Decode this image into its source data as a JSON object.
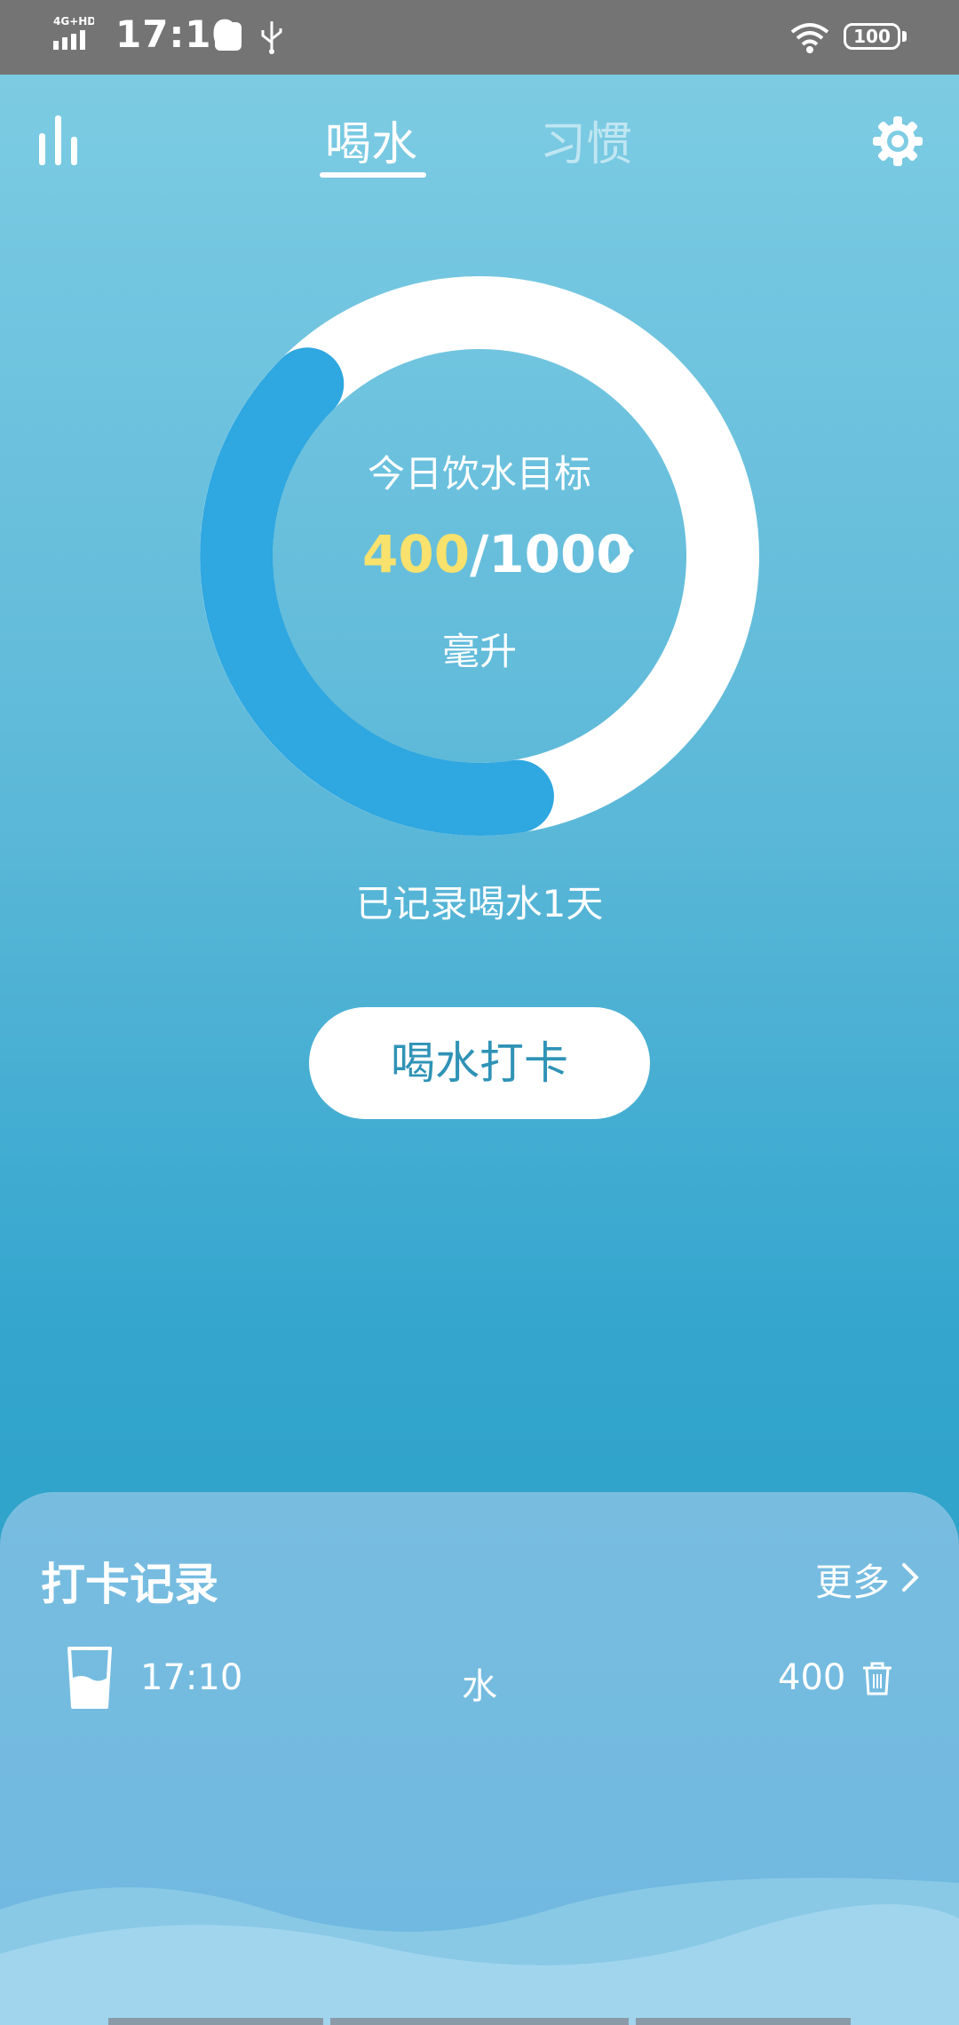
{
  "status_bar": {
    "network": "4G+HD",
    "time": "17:10",
    "battery": "100"
  },
  "header": {
    "tabs": [
      {
        "label": "喝水",
        "active": true
      },
      {
        "label": "习惯",
        "active": false
      }
    ],
    "icons": {
      "left": "bar-chart-icon",
      "right": "gear-icon"
    }
  },
  "goal": {
    "title": "今日饮水目标",
    "current": "400",
    "separator": "/",
    "target": "1000",
    "unit": "毫升",
    "progress_fraction": 0.4
  },
  "recorded_days": "已记录喝水1天",
  "checkin_button": "喝水打卡",
  "records": {
    "title": "打卡记录",
    "more": "更多",
    "items": [
      {
        "time": "17:10",
        "type": "水",
        "amount": "400",
        "icon": "water-cup-icon"
      }
    ]
  },
  "colors": {
    "progress": "#2fa7e0",
    "highlight": "#f8e16c",
    "button_text": "#2f93b6"
  }
}
